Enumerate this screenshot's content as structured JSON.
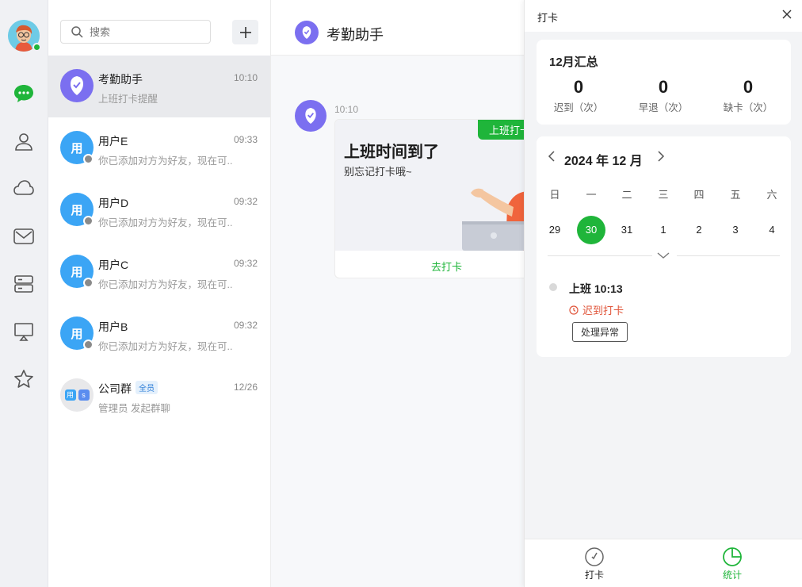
{
  "search": {
    "placeholder": "搜索"
  },
  "conversations": [
    {
      "name": "考勤助手",
      "time": "10:10",
      "preview": "上班打卡提醒",
      "avatar_text": ""
    },
    {
      "name": "用户E",
      "time": "09:33",
      "preview": "你已添加对方为好友，现在可...",
      "avatar_text": "用"
    },
    {
      "name": "用户D",
      "time": "09:32",
      "preview": "你已添加对方为好友，现在可...",
      "avatar_text": "用"
    },
    {
      "name": "用户C",
      "time": "09:32",
      "preview": "你已添加对方为好友，现在可...",
      "avatar_text": "用"
    },
    {
      "name": "用户B",
      "time": "09:32",
      "preview": "你已添加对方为好友，现在可...",
      "avatar_text": "用"
    },
    {
      "name": "公司群",
      "badge": "全员",
      "time": "12/26",
      "preview": "管理员 发起群聊",
      "avatar_text": [
        "用",
        "s"
      ]
    }
  ],
  "chat": {
    "title": "考勤助手",
    "message_time": "10:10",
    "card": {
      "tag": "上班打卡",
      "title": "上班时间到了",
      "subtitle": "别忘记打卡哦~",
      "action": "去打卡"
    }
  },
  "panel": {
    "title": "打卡",
    "summary": {
      "title": "12月汇总",
      "stats": [
        {
          "value": "0",
          "label": "迟到（次）"
        },
        {
          "value": "0",
          "label": "早退（次）"
        },
        {
          "value": "0",
          "label": "缺卡（次）"
        }
      ]
    },
    "calendar": {
      "month": "2024 年 12 月",
      "weekdays": [
        "日",
        "一",
        "二",
        "三",
        "四",
        "五",
        "六"
      ],
      "days": [
        "29",
        "30",
        "31",
        "1",
        "2",
        "3",
        "4"
      ],
      "today": "30"
    },
    "record": {
      "title": "上班 10:13",
      "status": "迟到打卡",
      "button": "处理异常"
    },
    "tabs": [
      {
        "label": "打卡",
        "icon": "clock-hand-icon"
      },
      {
        "label": "统计",
        "icon": "pie-chart-icon"
      }
    ]
  },
  "colors": {
    "accent_green": "#1fb53a",
    "assistant_purple": "#7b6ff0",
    "user_blue": "#3ba5f5",
    "late_red": "#e0553a"
  }
}
